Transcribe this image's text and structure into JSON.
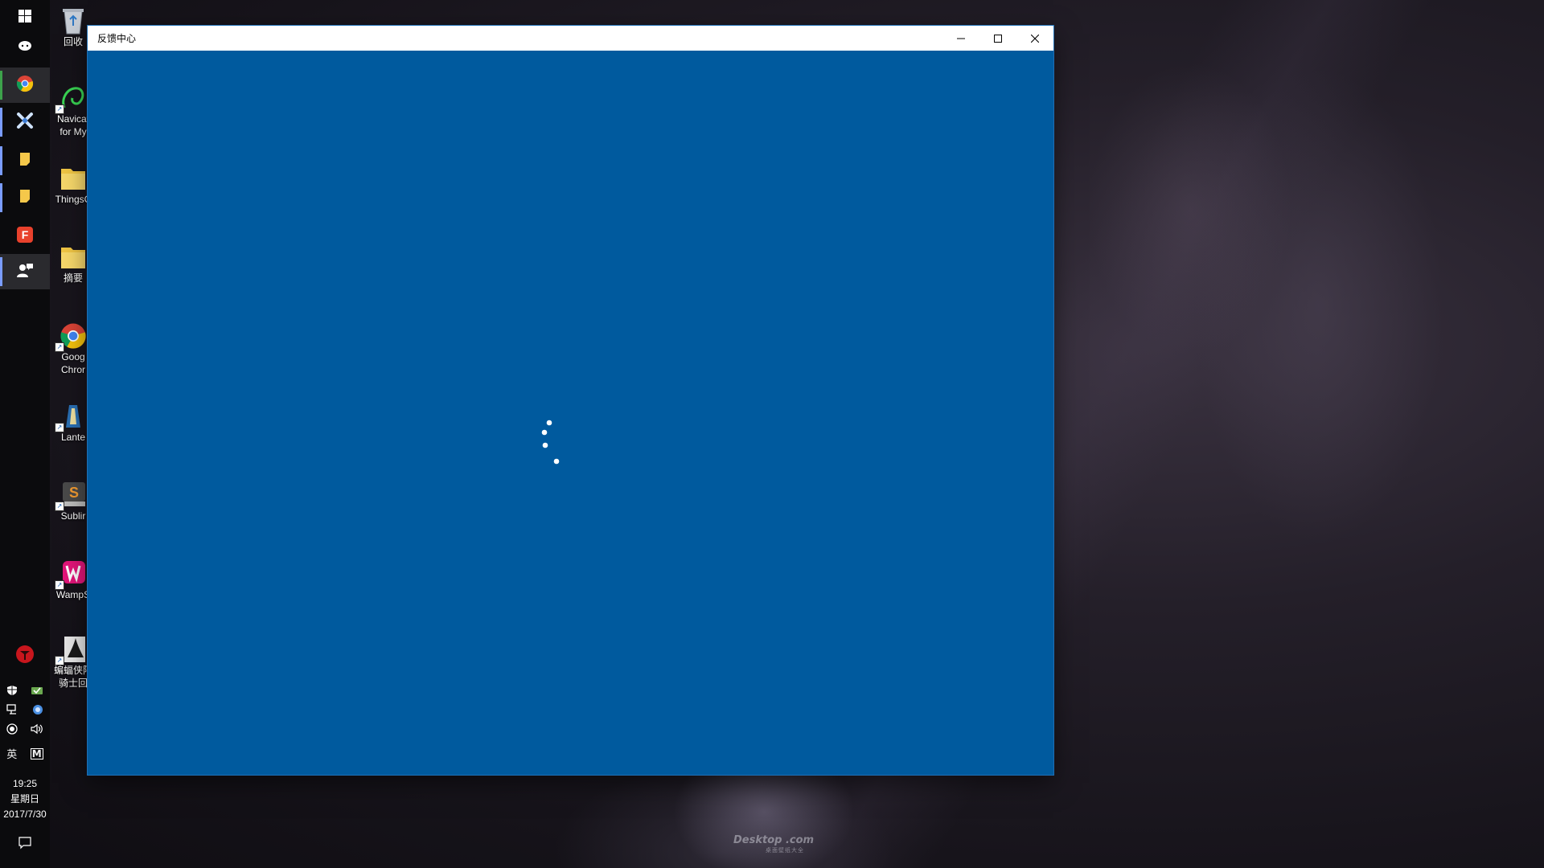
{
  "taskbar": {
    "apps": [
      {
        "name": "start-button",
        "icon": "windows-logo-icon"
      },
      {
        "name": "taskbar-chat-app",
        "icon": "chat-bubble-icon"
      },
      {
        "name": "taskbar-chrome",
        "icon": "chrome-icon"
      },
      {
        "name": "taskbar-tools-app",
        "icon": "crossed-tools-icon"
      },
      {
        "name": "taskbar-sticky-1",
        "icon": "sticky-note-icon"
      },
      {
        "name": "taskbar-sticky-2",
        "icon": "sticky-note-icon"
      },
      {
        "name": "taskbar-foxit",
        "icon": "foxit-f-icon"
      },
      {
        "name": "taskbar-feedback-hub",
        "icon": "feedback-person-icon"
      }
    ],
    "tray_app": {
      "icon": "red-circle-app-icon"
    },
    "ime_lang": "英",
    "ime_mode": "M",
    "clock": {
      "time": "19:25",
      "weekday": "星期日",
      "date": "2017/7/30"
    }
  },
  "desktop": {
    "icons": [
      {
        "label": "回收",
        "icon": "recycle-bin-icon"
      },
      {
        "label": "Navicat for My",
        "icon": "navicat-icon"
      },
      {
        "label": "ThingsC",
        "icon": "folder-icon"
      },
      {
        "label": "摘要",
        "icon": "folder-icon"
      },
      {
        "label": "Goog Chror",
        "icon": "chrome-icon"
      },
      {
        "label": "Lante",
        "icon": "lantern-icon"
      },
      {
        "label": "Sublir",
        "icon": "sublime-icon"
      },
      {
        "label": "WampS",
        "icon": "wampserver-icon"
      },
      {
        "label": "蝙蝠侠阿 骑士回",
        "icon": "batman-game-icon"
      }
    ],
    "watermark": {
      "main": "Desktop   .com",
      "sub": "桌面壁纸大全"
    }
  },
  "window": {
    "title": "反馈中心",
    "background": "#005a9e",
    "controls": {
      "minimize": "minimize-icon",
      "maximize": "maximize-icon",
      "close": "close-icon"
    },
    "state": "loading"
  }
}
